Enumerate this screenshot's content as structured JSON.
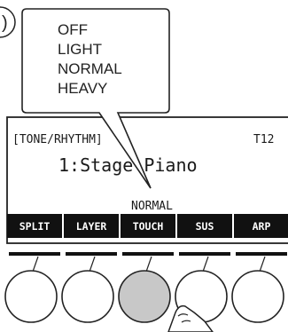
{
  "step_marker": ")",
  "callout": {
    "options": [
      "OFF",
      "LIGHT",
      "NORMAL",
      "HEAVY"
    ]
  },
  "lcd": {
    "header_left": "[TONE/RHYTHM]",
    "header_right": "T12",
    "tone_line": "1:Stage Piano",
    "setting_value": "NORMAL",
    "softkeys": [
      "SPLIT",
      "LAYER",
      "TOUCH",
      "SUS",
      "ARP"
    ],
    "active_softkey": "TOUCH"
  },
  "colors": {
    "softkey_bar": "#111111",
    "lcd_background": "#ffffff",
    "pressed_button": "#c8c8c8",
    "outline": "#222222"
  },
  "icons": [
    "finger-pointer-icon"
  ]
}
